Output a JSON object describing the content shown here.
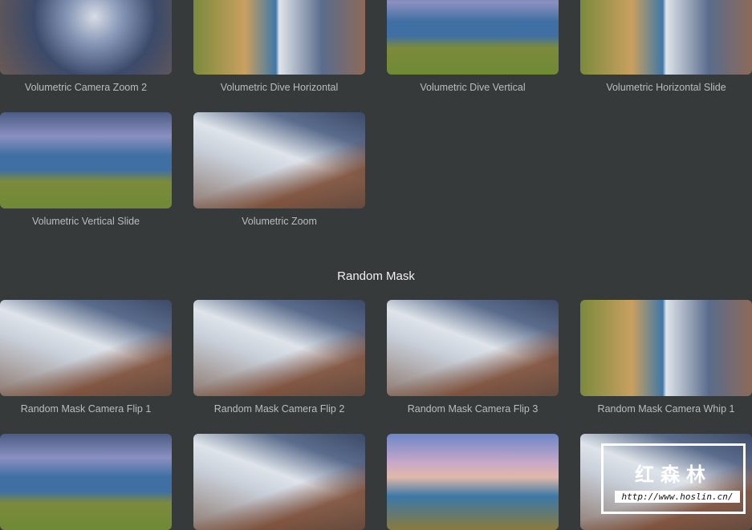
{
  "sections": [
    {
      "items": [
        {
          "label": "Volumetric Camera Zoom 2",
          "style": "zoomblur"
        },
        {
          "label": "Volumetric Dive Horizontal",
          "style": "mix"
        },
        {
          "label": "Volumetric Dive Vertical",
          "style": "coast"
        },
        {
          "label": "Volumetric Horizontal Slide",
          "style": "mix"
        },
        {
          "label": "Volumetric Vertical Slide",
          "style": "coast"
        },
        {
          "label": "Volumetric Zoom",
          "style": "mtn"
        }
      ]
    },
    {
      "title": "Random Mask",
      "items": [
        {
          "label": "Random Mask Camera Flip 1",
          "style": "mtn"
        },
        {
          "label": "Random Mask Camera Flip 2",
          "style": "mtn"
        },
        {
          "label": "Random Mask Camera Flip 3",
          "style": "mtn"
        },
        {
          "label": "Random Mask Camera Whip 1",
          "style": "mix"
        },
        {
          "label": "",
          "style": "coast"
        },
        {
          "label": "",
          "style": "mtn"
        },
        {
          "label": "",
          "style": "sky"
        },
        {
          "label": "",
          "style": "mtn"
        }
      ]
    }
  ],
  "watermark": {
    "title": "红森林",
    "url": "http://www.hoslin.cn/"
  }
}
